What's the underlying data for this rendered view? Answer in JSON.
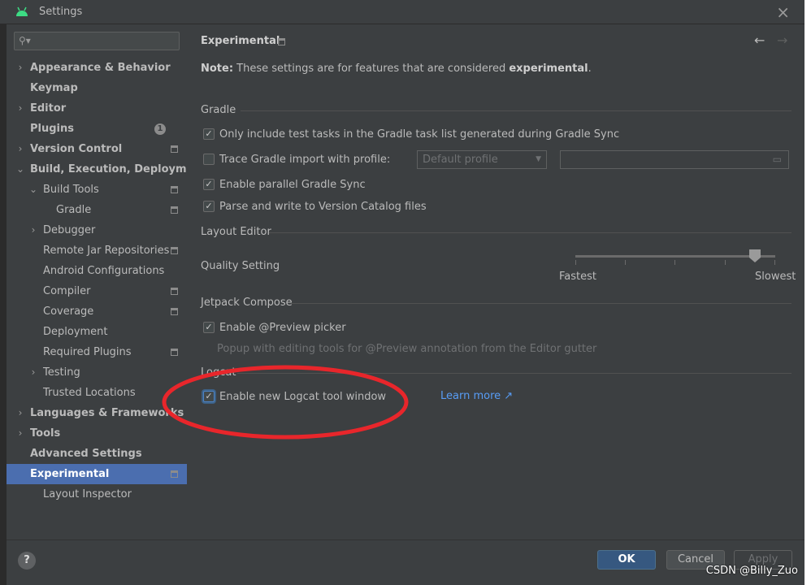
{
  "window": {
    "title": "Settings"
  },
  "sidebar": {
    "search_placeholder": "",
    "items": [
      {
        "label": "Appearance & Behavior",
        "bold": true,
        "chevron": "›",
        "indent": 0
      },
      {
        "label": "Keymap",
        "bold": true,
        "chevron": "",
        "indent": 0
      },
      {
        "label": "Editor",
        "bold": true,
        "chevron": "›",
        "indent": 0
      },
      {
        "label": "Plugins",
        "bold": true,
        "chevron": "",
        "indent": 0,
        "badge": "1"
      },
      {
        "label": "Version Control",
        "bold": true,
        "chevron": "›",
        "indent": 0,
        "project_icon": true
      },
      {
        "label": "Build, Execution, Deployment",
        "bold": true,
        "chevron": "⌄",
        "indent": 0
      },
      {
        "label": "Build Tools",
        "bold": false,
        "chevron": "⌄",
        "indent": 1,
        "project_icon": true
      },
      {
        "label": "Gradle",
        "bold": false,
        "chevron": "",
        "indent": 2,
        "project_icon": true
      },
      {
        "label": "Debugger",
        "bold": false,
        "chevron": "›",
        "indent": 1
      },
      {
        "label": "Remote Jar Repositories",
        "bold": false,
        "chevron": "",
        "indent": 1,
        "project_icon": true
      },
      {
        "label": "Android Configurations",
        "bold": false,
        "chevron": "",
        "indent": 1
      },
      {
        "label": "Compiler",
        "bold": false,
        "chevron": "",
        "indent": 1,
        "project_icon": true
      },
      {
        "label": "Coverage",
        "bold": false,
        "chevron": "",
        "indent": 1,
        "project_icon": true
      },
      {
        "label": "Deployment",
        "bold": false,
        "chevron": "",
        "indent": 1
      },
      {
        "label": "Required Plugins",
        "bold": false,
        "chevron": "",
        "indent": 1,
        "project_icon": true
      },
      {
        "label": "Testing",
        "bold": false,
        "chevron": "›",
        "indent": 1
      },
      {
        "label": "Trusted Locations",
        "bold": false,
        "chevron": "",
        "indent": 1
      },
      {
        "label": "Languages & Frameworks",
        "bold": true,
        "chevron": "›",
        "indent": 0
      },
      {
        "label": "Tools",
        "bold": true,
        "chevron": "›",
        "indent": 0
      },
      {
        "label": "Advanced Settings",
        "bold": true,
        "chevron": "",
        "indent": 0
      },
      {
        "label": "Experimental",
        "bold": true,
        "chevron": "",
        "indent": 0,
        "project_icon": true,
        "selected": true
      },
      {
        "label": "Layout Inspector",
        "bold": false,
        "chevron": "",
        "indent": 1
      }
    ]
  },
  "main": {
    "header": {
      "title": "Experimental",
      "back": "←",
      "forward": "→"
    },
    "note": {
      "prefix": "Note:",
      "text": " These settings are for features that are considered ",
      "emph": "experimental",
      "suffix": "."
    },
    "gradle": {
      "title": "Gradle",
      "only_test_tasks": {
        "label": "Only include test tasks in the Gradle task list generated during Gradle Sync",
        "checked": true
      },
      "trace_import": {
        "label": "Trace Gradle import with profile:",
        "checked": false,
        "profile_value": "Default profile",
        "path_value": ""
      },
      "parallel_sync": {
        "label": "Enable parallel Gradle Sync",
        "checked": true
      },
      "version_catalog": {
        "label": "Parse and write to Version Catalog files",
        "checked": true
      }
    },
    "layout_editor": {
      "title": "Layout Editor",
      "quality_label": "Quality Setting",
      "min_label": "Fastest",
      "max_label": "Slowest",
      "slider_fraction": 0.9
    },
    "jetpack_compose": {
      "title": "Jetpack Compose",
      "preview_picker": {
        "label": "Enable @Preview picker",
        "checked": true
      },
      "description": "Popup with editing tools for @Preview annotation from the Editor gutter"
    },
    "logcat": {
      "title": "Logcat",
      "new_logcat": {
        "label": "Enable new Logcat tool window",
        "checked": true
      },
      "learn_more": "Learn more ↗"
    }
  },
  "footer": {
    "help": "?",
    "ok": "OK",
    "cancel": "Cancel",
    "apply": "Apply"
  },
  "watermark": "CSDN @Billy_Zuo",
  "colors": {
    "accent": "#4b6eaf",
    "annotation": "#e8262b",
    "link": "#589df6"
  }
}
